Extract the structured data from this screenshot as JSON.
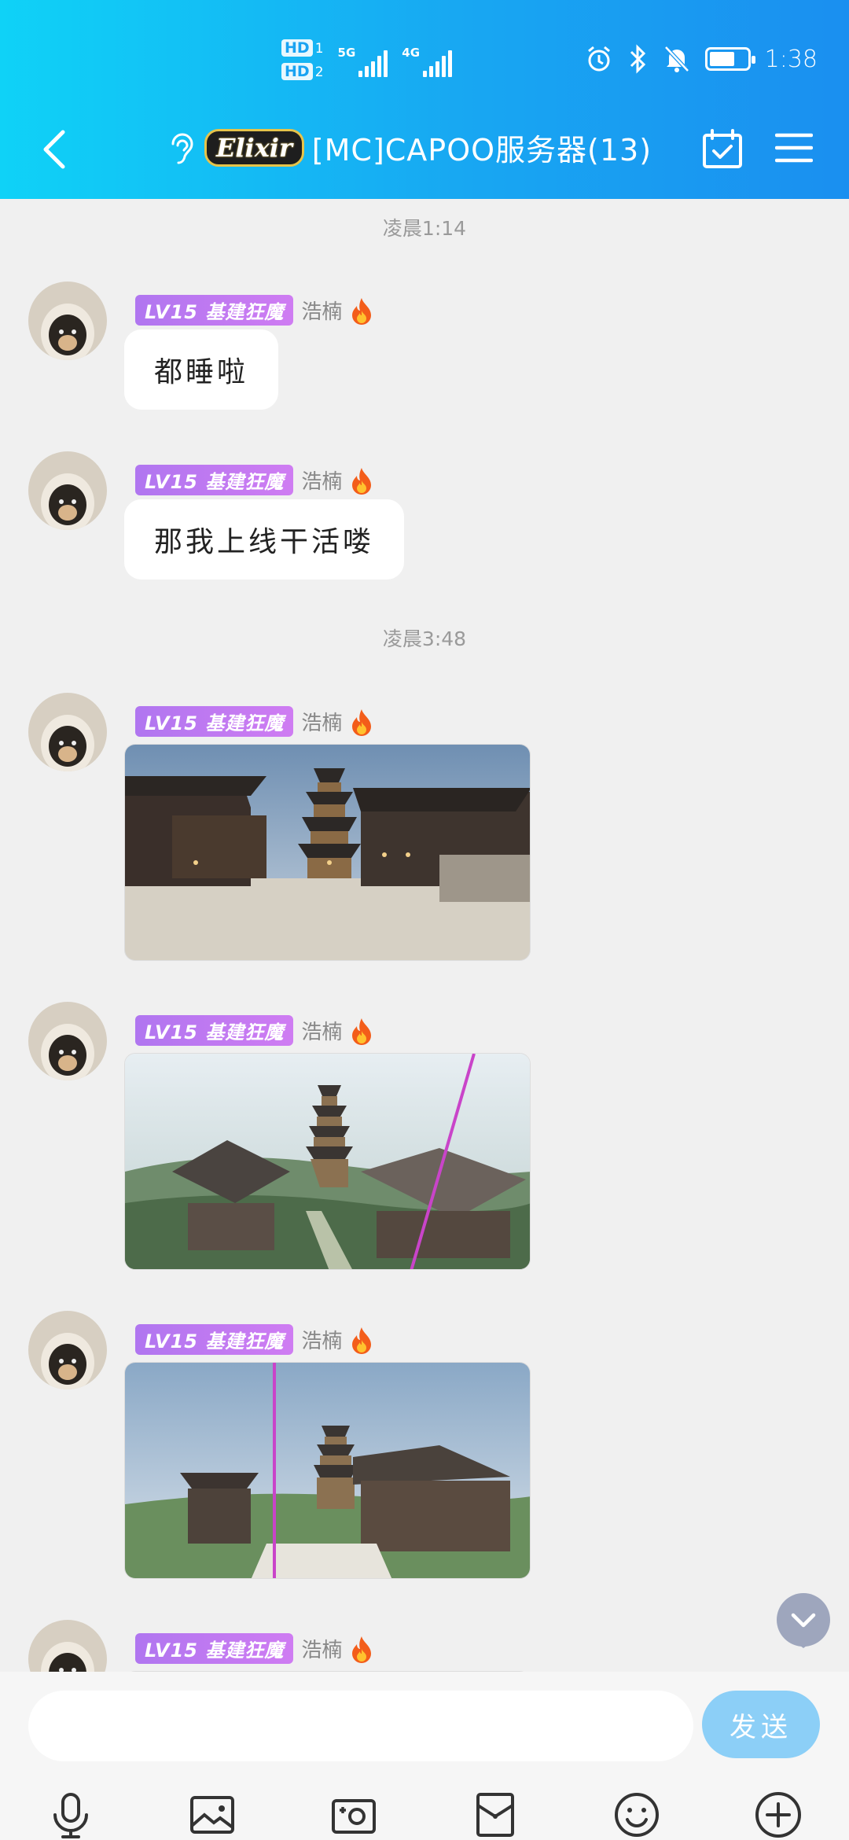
{
  "status_bar": {
    "hd1": "HD",
    "hd1_num": "1",
    "hd2": "HD",
    "hd2_num": "2",
    "net1": "5G",
    "net2": "4G",
    "time": "1:38",
    "battery_level": 0.72
  },
  "header": {
    "group_badge": "Elixir",
    "title": "[MC]CAPOO服务器(13)"
  },
  "messages": [
    {
      "type": "time",
      "text": "凌晨1:14"
    },
    {
      "type": "text",
      "level": "LV15 基建狂魔",
      "sender": "浩楠",
      "text": "都睡啦"
    },
    {
      "type": "text",
      "level": "LV15 基建狂魔",
      "sender": "浩楠",
      "text": "那我上线干活喽"
    },
    {
      "type": "time",
      "text": "凌晨3:48"
    },
    {
      "type": "image",
      "level": "LV15 基建狂魔",
      "sender": "浩楠"
    },
    {
      "type": "image",
      "level": "LV15 基建狂魔",
      "sender": "浩楠"
    },
    {
      "type": "image",
      "level": "LV15 基建狂魔",
      "sender": "浩楠"
    },
    {
      "type": "image",
      "level": "LV15 基建狂魔",
      "sender": "浩楠"
    }
  ],
  "input": {
    "placeholder": "",
    "send_label": "发送"
  },
  "toolbar": {
    "icons": [
      "microphone-icon",
      "photo-icon",
      "camera-icon",
      "red-packet-icon",
      "emoji-icon",
      "plus-icon"
    ]
  },
  "colors": {
    "header_start": "#0fd2f7",
    "header_end": "#1a8ff0",
    "level_badge": "#c27af2",
    "send_button": "#8ccff7"
  }
}
